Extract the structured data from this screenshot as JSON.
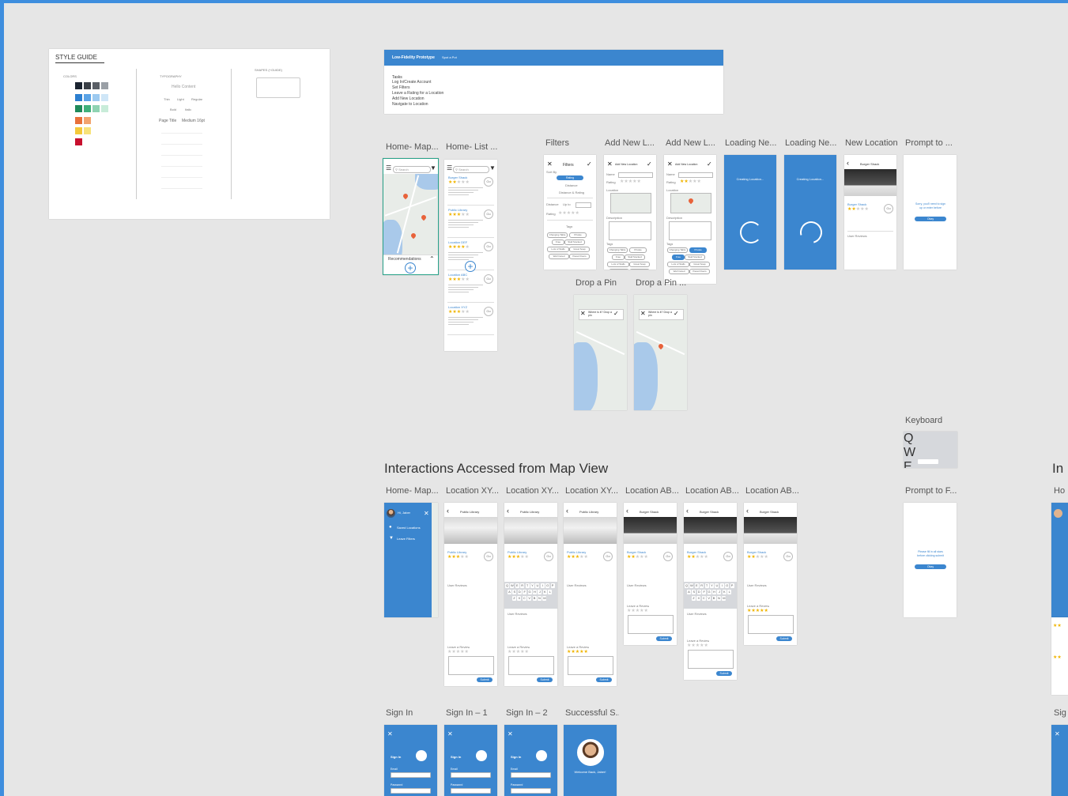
{
  "style_guide": {
    "title": "STYLE GUIDE",
    "colors_heading": "COLORS",
    "typography_heading": "TYPOGRAPHY",
    "shapes_heading": "SHAPES (+GUIDE)",
    "font_sample": "Hello Content",
    "weights": [
      "Thin",
      "Light",
      "Regular",
      "Bold",
      "Italic"
    ],
    "page_title_row": "Page Title",
    "page_title_spec": "Medium 16pt",
    "swatches": [
      "#1b2330",
      "#3a3f47",
      "#5a5f66",
      "#9aa0a6",
      "#2d7fd0",
      "#5aa3e6",
      "#9dcaf0",
      "#cfe6f7",
      "#1f8a5a",
      "#3fb07a",
      "#8fd3b2",
      "#c8ecd9",
      "#e8703a",
      "#f2a36d",
      "#f4c93a",
      "#f7e27a",
      "#c8102e"
    ]
  },
  "prototype_banner": {
    "title": "Low-Fidelity Prototype",
    "subtitle": "Spot a Pot",
    "tasks_heading": "Tasks",
    "tasks": [
      "Log In/Create Account",
      "Set Filters",
      "Leave a Rating for a Location",
      "Add New Location",
      "Navigate to Location"
    ]
  },
  "row1_labels": [
    "Home- Map...",
    "Home- List ...",
    "Filters",
    "Add New L...",
    "Add New L...",
    "Loading Ne...",
    "Loading Ne...",
    "New Location",
    "Prompt to ..."
  ],
  "drop_pin_labels": [
    "Drop a Pin",
    "Drop a Pin ..."
  ],
  "keyboard_label": "Keyboard",
  "section_title": "Interactions Accessed from Map View",
  "section_title_partial": "In",
  "row2_labels": [
    "Home- Map...",
    "Location XY...",
    "Location XY...",
    "Location XY...",
    "Location AB...",
    "Location AB...",
    "Location AB...",
    "Prompt to F...",
    "Ho"
  ],
  "row3_labels": [
    "Sign In",
    "Sign In – 1",
    "Sign In – 2",
    "Successful S...",
    "Sig"
  ],
  "screens": {
    "search_placeholder": "Search",
    "recommendations": "Recommendations",
    "list_items": [
      "Burger Shack",
      "Public Library",
      "Location DEF",
      "Location ABC",
      "Location XYZ"
    ],
    "go": "Go",
    "filters_title": "Filters",
    "sort_by": "Sort By",
    "sort_options": [
      "Rating",
      "Distance",
      "Distance & Rating"
    ],
    "distance": "Distance",
    "up_to": "Up to",
    "rating": "Rating",
    "tags": "Tags",
    "tag_options": [
      "Changing Table",
      "Private",
      "Free",
      "Stall Stocked",
      "Lots of Stalls",
      "Great Soap",
      "Well Cared",
      "Paved Doors"
    ],
    "add_new_location": "Add New Location",
    "name": "Name",
    "location": "Location",
    "description": "Description",
    "creating_location": "Creating Location...",
    "new_location_title": "Burger Shack",
    "prompt_signup": "Sorry, you'll need to sign up or enter before",
    "prompt_ok": "Okay",
    "drop_pin_hint": "Where is it? Drop a pin",
    "prompt_rating": "Please fill in all stars before clicking submit",
    "leave_review": "Leave a Review",
    "submit": "Submit",
    "user_reviews": "User Reviews",
    "sidebar_user": "Hi, Jaber",
    "sidebar_items": [
      "Saved Locations",
      "Add Location",
      "Leave Filters"
    ],
    "sign_in": "Sign In",
    "email": "Email",
    "password": "Password",
    "welcome": "Welcome Back, Jaber!",
    "keyboard_keys": [
      "Q",
      "W",
      "E",
      "R",
      "T",
      "Y",
      "U",
      "I",
      "O",
      "P",
      "A",
      "S",
      "D",
      "F",
      "G",
      "H",
      "J",
      "K",
      "L",
      "Z",
      "X",
      "C",
      "V",
      "B",
      "N",
      "M"
    ]
  }
}
